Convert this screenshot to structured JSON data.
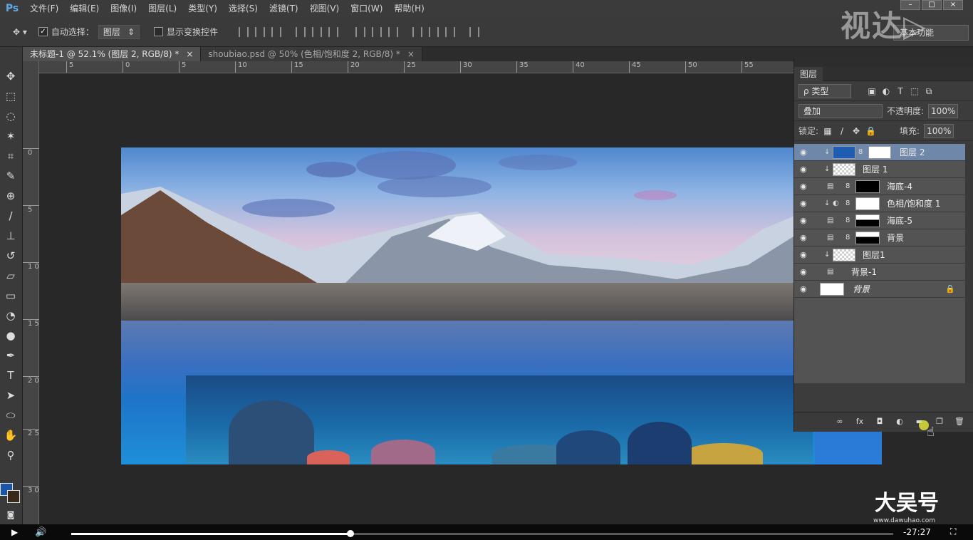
{
  "app": {
    "logo": "Ps"
  },
  "menu": [
    "文件(F)",
    "编辑(E)",
    "图像(I)",
    "图层(L)",
    "类型(Y)",
    "选择(S)",
    "滤镜(T)",
    "视图(V)",
    "窗口(W)",
    "帮助(H)"
  ],
  "options": {
    "auto_select_label": "自动选择：",
    "auto_select_target": "图层",
    "auto_select_checked": true,
    "transform_controls_label": "显示变换控件",
    "workspace": "基本功能"
  },
  "watermark_top": "视达▷",
  "tabs": [
    {
      "label": "未标题-1 @ 52.1% (图层 2, RGB/8) *",
      "close": "×",
      "active": true
    },
    {
      "label": "shoubiao.psd @ 50% (色相/饱和度 2, RGB/8) *",
      "close": "×",
      "active": false
    }
  ],
  "ruler_h": [
    "5",
    "0",
    "5",
    "10",
    "15",
    "20",
    "25",
    "30",
    "35",
    "40",
    "45",
    "50",
    "55"
  ],
  "ruler_v": [
    "0",
    "5",
    "1 0",
    "1 5",
    "2 0",
    "2 5",
    "3 0"
  ],
  "layers_panel": {
    "tab": "图层",
    "filter_kind": "ρ 类型",
    "blend_mode": "叠加",
    "opacity_label": "不透明度:",
    "opacity": "100%",
    "lock_label": "锁定:",
    "fill_label": "填充:",
    "fill": "100%",
    "layers": [
      {
        "name": "图层 2",
        "selected": true
      },
      {
        "name": "图层 1",
        "selected": false
      },
      {
        "name": "海底-4",
        "selected": false
      },
      {
        "name": "色相/饱和度 1",
        "selected": false
      },
      {
        "name": "海底-5",
        "selected": false
      },
      {
        "name": "背景",
        "selected": false
      },
      {
        "name": "图层1",
        "selected": false
      },
      {
        "name": "背景-1",
        "selected": false
      },
      {
        "name": "背景",
        "selected": false
      }
    ]
  },
  "player": {
    "time": "-27:27",
    "progress": 0.34
  },
  "watermark_br": "大吴号",
  "watermark_br_url": "www.dawuhao.com",
  "colors": {
    "accent": "#5ea8e8",
    "selected_layer": "#6f87a8",
    "foreground": "#1a56a8",
    "background": "#3a2a1a"
  }
}
